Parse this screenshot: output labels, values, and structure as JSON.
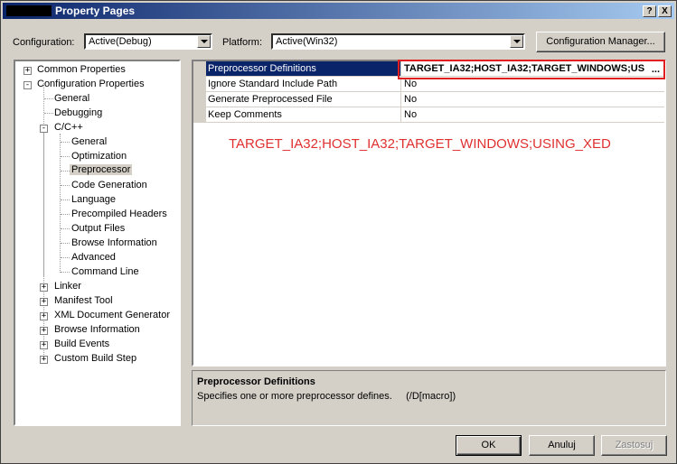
{
  "window": {
    "title": "Property Pages",
    "help_glyph": "?",
    "close_glyph": "X"
  },
  "toolbar": {
    "configuration_label": "Configuration:",
    "configuration_value": "Active(Debug)",
    "platform_label": "Platform:",
    "platform_value": "Active(Win32)",
    "config_manager_label": "Configuration Manager..."
  },
  "tree": {
    "items": [
      {
        "label": "Common Properties"
      },
      {
        "label": "Configuration Properties"
      },
      {
        "label": "General"
      },
      {
        "label": "Debugging"
      },
      {
        "label": "C/C++"
      },
      {
        "label": "General"
      },
      {
        "label": "Optimization"
      },
      {
        "label": "Preprocessor"
      },
      {
        "label": "Code Generation"
      },
      {
        "label": "Language"
      },
      {
        "label": "Precompiled Headers"
      },
      {
        "label": "Output Files"
      },
      {
        "label": "Browse Information"
      },
      {
        "label": "Advanced"
      },
      {
        "label": "Command Line"
      },
      {
        "label": "Linker"
      },
      {
        "label": "Manifest Tool"
      },
      {
        "label": "XML Document Generator"
      },
      {
        "label": "Browse Information"
      },
      {
        "label": "Build Events"
      },
      {
        "label": "Custom Build Step"
      }
    ],
    "expand_plus": "+",
    "expand_minus": "-"
  },
  "grid": {
    "rows": [
      {
        "name": "Preprocessor Definitions",
        "value": "TARGET_IA32;HOST_IA32;TARGET_WINDOWS;US"
      },
      {
        "name": "Ignore Standard Include Path",
        "value": "No"
      },
      {
        "name": "Generate Preprocessed File",
        "value": "No"
      },
      {
        "name": "Keep Comments",
        "value": "No"
      }
    ],
    "ellipsis": "..."
  },
  "annotation": {
    "text": "TARGET_IA32;HOST_IA32;TARGET_WINDOWS;USING_XED",
    "color": "#e03030"
  },
  "description": {
    "title": "Preprocessor Definitions",
    "text": "Specifies one or more preprocessor defines.     (/D[macro])"
  },
  "buttons": {
    "ok": "OK",
    "cancel": "Anuluj",
    "apply": "Zastosuj"
  },
  "colors": {
    "selection": "#0a246a",
    "highlight_box": "#e02020"
  }
}
